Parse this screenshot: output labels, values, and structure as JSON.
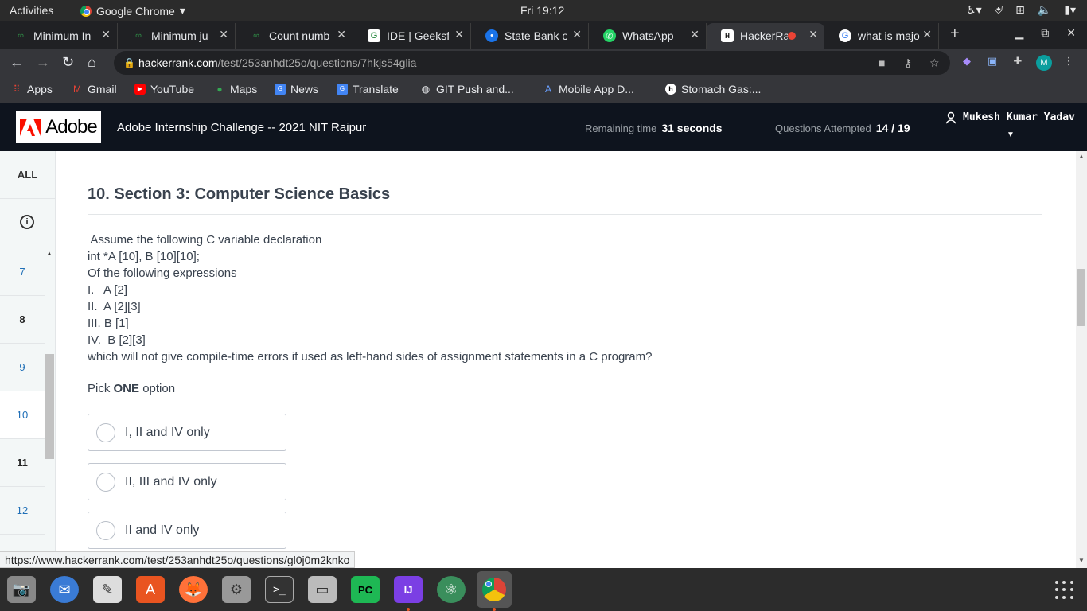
{
  "topbar": {
    "activities": "Activities",
    "app_name": "Google Chrome",
    "clock": "Fri 19:12"
  },
  "tabs": [
    {
      "label": "Minimum In",
      "icon": "geeks-icon"
    },
    {
      "label": "Minimum ju",
      "icon": "geeks-icon"
    },
    {
      "label": "Count numb",
      "icon": "geeks-icon"
    },
    {
      "label": "IDE | Geeksf",
      "icon": "geeks-ide-icon"
    },
    {
      "label": "State Bank o",
      "icon": "sbi-icon"
    },
    {
      "label": "WhatsApp",
      "icon": "whatsapp-icon"
    },
    {
      "label": "HackerRa",
      "icon": "hackerrank-icon",
      "active": true
    },
    {
      "label": "what is majo",
      "icon": "google-icon"
    }
  ],
  "address": {
    "host": "hackerrank.com",
    "path": "/test/253anhdt25o/questions/7hkjs54glia",
    "profile_initial": "M"
  },
  "bookmarks": [
    {
      "label": "Apps"
    },
    {
      "label": "Gmail"
    },
    {
      "label": "YouTube"
    },
    {
      "label": "Maps"
    },
    {
      "label": "News"
    },
    {
      "label": "Translate"
    },
    {
      "label": "GIT Push and..."
    },
    {
      "label": "Mobile App D..."
    },
    {
      "label": "Stomach Gas:..."
    }
  ],
  "header": {
    "logo_text": "Adobe",
    "challenge_title": "Adobe Internship Challenge -- 2021 NIT Raipur",
    "remaining_label": "Remaining time",
    "remaining_value": "31 seconds",
    "attempted_label": "Questions Attempted",
    "attempted_value": "14 / 19",
    "user_name": "Mukesh Kumar Yadav"
  },
  "sidebar": {
    "all_label": "ALL",
    "items": [
      {
        "num": "7",
        "state": "unattempted"
      },
      {
        "num": "8",
        "state": "attempted"
      },
      {
        "num": "9",
        "state": "unattempted"
      },
      {
        "num": "10",
        "state": "current"
      },
      {
        "num": "11",
        "state": "attempted"
      },
      {
        "num": "12",
        "state": "unattempted"
      }
    ]
  },
  "question": {
    "title": "10. Section 3: Computer Science Basics",
    "lines": [
      " Assume the following C variable declaration",
      "int *A [10], B [10][10];",
      "Of the following expressions",
      "I.   A [2]",
      "II.  A [2][3]",
      "III. B [1]",
      "IV.  B [2][3]",
      "which will not give compile-time errors if used as left-hand sides of assignment statements in a C program?"
    ],
    "pick_prefix": "Pick ",
    "pick_bold": "ONE",
    "pick_suffix": " option",
    "options": [
      "I, II and IV only",
      "II, III and IV only",
      "II and IV only"
    ]
  },
  "status_url": "https://www.hackerrank.com/test/253anhdt25o/questions/gl0j0m2knko"
}
